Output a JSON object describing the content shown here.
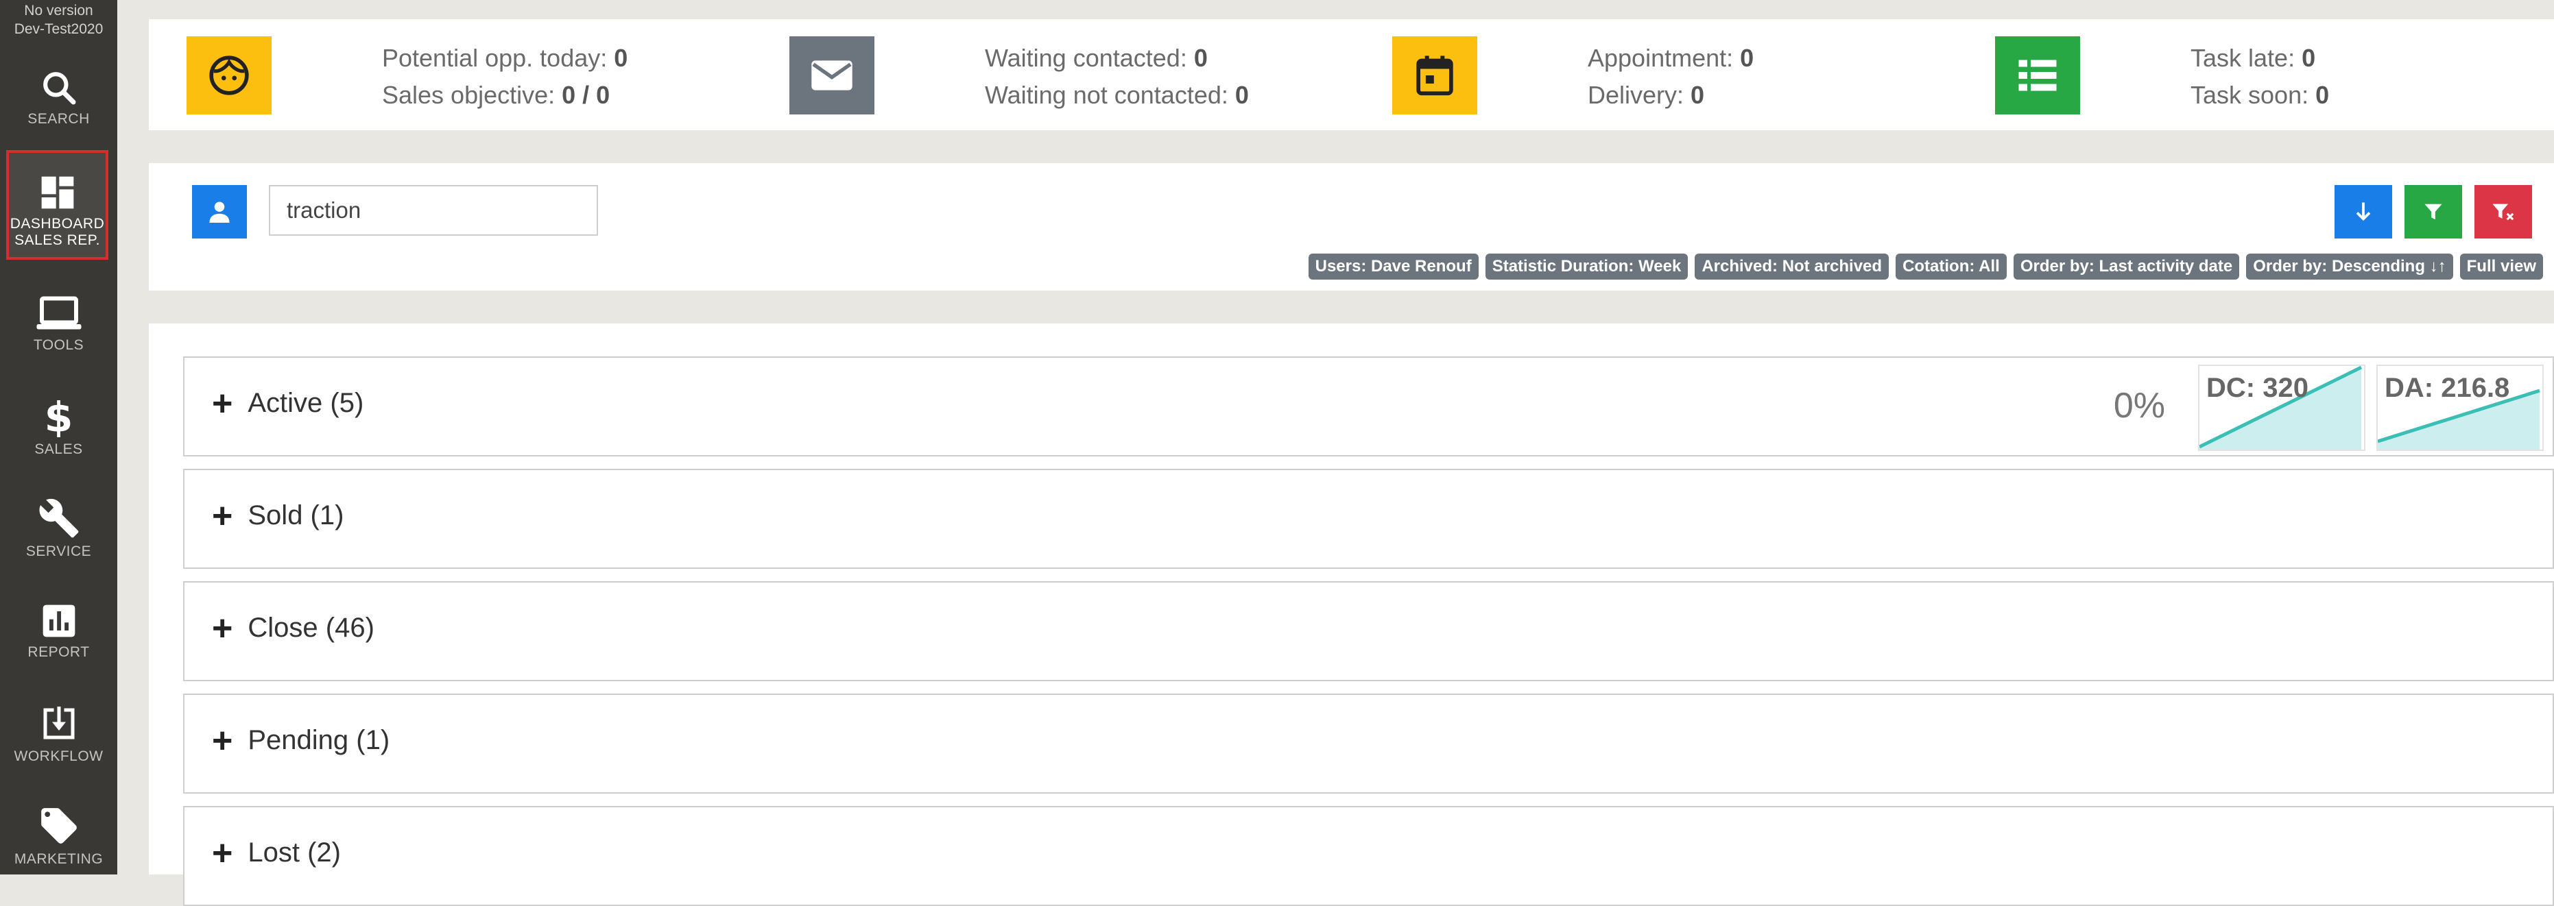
{
  "sidebar": {
    "version_line1": "No version",
    "version_line2": "Dev-Test2020",
    "items": [
      {
        "label": "SEARCH",
        "icon": "search-icon"
      },
      {
        "label_line1": "DASHBOARD",
        "label_line2": "SALES REP.",
        "icon": "dashboard-icon"
      },
      {
        "label": "TOOLS",
        "icon": "laptop-icon"
      },
      {
        "label": "SALES",
        "icon": "dollar-icon"
      },
      {
        "label": "SERVICE",
        "icon": "wrench-icon"
      },
      {
        "label": "REPORT",
        "icon": "bar-chart-icon"
      },
      {
        "label": "WORKFLOW",
        "icon": "download-box-icon"
      },
      {
        "label": "MARKETING",
        "icon": "tag-icon"
      }
    ]
  },
  "stats": [
    {
      "icon": "face-icon",
      "color": "#fdbf0f",
      "line1_label": "Potential opp. today:",
      "line1_value": "0",
      "line2_label": "Sales objective:",
      "line2_value": "0 / 0"
    },
    {
      "icon": "envelope-icon",
      "color": "#6c757d",
      "line1_label": "Waiting contacted:",
      "line1_value": "0",
      "line2_label": "Waiting not contacted:",
      "line2_value": "0"
    },
    {
      "icon": "calendar-icon",
      "color": "#fdbf0f",
      "line1_label": "Appointment:",
      "line1_value": "0",
      "line2_label": "Delivery:",
      "line2_value": "0"
    },
    {
      "icon": "list-icon",
      "color": "#28a745",
      "line1_label": "Task late:",
      "line1_value": "0",
      "line2_label": "Task soon:",
      "line2_value": "0"
    }
  ],
  "filters": {
    "search_value": "traction",
    "badges": [
      "Users: Dave Renouf",
      "Statistic Duration: Week",
      "Archived: Not archived",
      "Cotation: All",
      "Order by: Last activity date",
      "Order by: Descending ↓↑",
      "Full view"
    ],
    "colors": {
      "user": "#1a7ee8",
      "sort": "#1a7ee8",
      "filter": "#28a745",
      "clear": "#dc3545"
    }
  },
  "sections": [
    {
      "title": "Active (5)",
      "percent": "0%",
      "spark1": "DC: 320",
      "spark2": "DA: 216.8"
    },
    {
      "title": "Sold (1)"
    },
    {
      "title": "Close (46)"
    },
    {
      "title": "Pending (1)"
    },
    {
      "title": "Lost (2)"
    }
  ]
}
